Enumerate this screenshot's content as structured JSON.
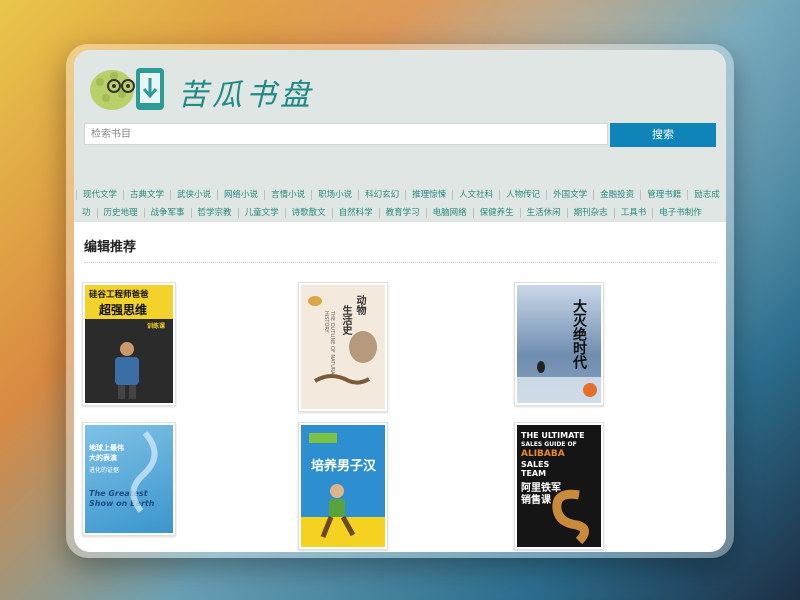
{
  "site": {
    "logo_text": "苦瓜书盘",
    "colors": {
      "accent": "#0e84b8",
      "header_bg": "#dfe6e3",
      "category_text": "#2a8a80"
    }
  },
  "search": {
    "placeholder": "检索书目",
    "button_label": "搜索"
  },
  "categories": {
    "row1": [
      "现代文学",
      "古典文学",
      "武侠小说",
      "网络小说",
      "言情小说",
      "职场小说",
      "科幻玄幻",
      "推理惊悚",
      "人文社科",
      "人物传记",
      "外国文学",
      "金融投资",
      "管理书籍",
      "励志成"
    ],
    "row2": [
      "功",
      "历史地理",
      "战争军事",
      "哲学宗教",
      "儿童文学",
      "诗歌散文",
      "自然科学",
      "教育学习",
      "电脑网络",
      "保健养生",
      "生活休闲",
      "期刊杂志",
      "工具书",
      "电子书制作"
    ]
  },
  "section": {
    "title": "编辑推荐"
  },
  "books": [
    {
      "cover_lines": [
        "硅谷工程师爸爸",
        "超强思维",
        "训练课"
      ]
    },
    {
      "cover_lines": [
        "动物",
        "生活史",
        "THE OUTLINE OF NATURAL HISTORY"
      ]
    },
    {
      "cover_lines": [
        "大灭绝时代"
      ]
    },
    {
      "cover_lines": [
        "地球上最伟大的表演",
        "进化的证据",
        "The Greatest Show on Earth"
      ]
    },
    {
      "cover_lines": [
        "培养男子汉"
      ]
    },
    {
      "cover_lines": [
        "THE ULTIMATE",
        "SALES GUIDE OF",
        "ALIBABA",
        "SALES",
        "TEAM",
        "阿里铁军",
        "销售课"
      ]
    }
  ]
}
